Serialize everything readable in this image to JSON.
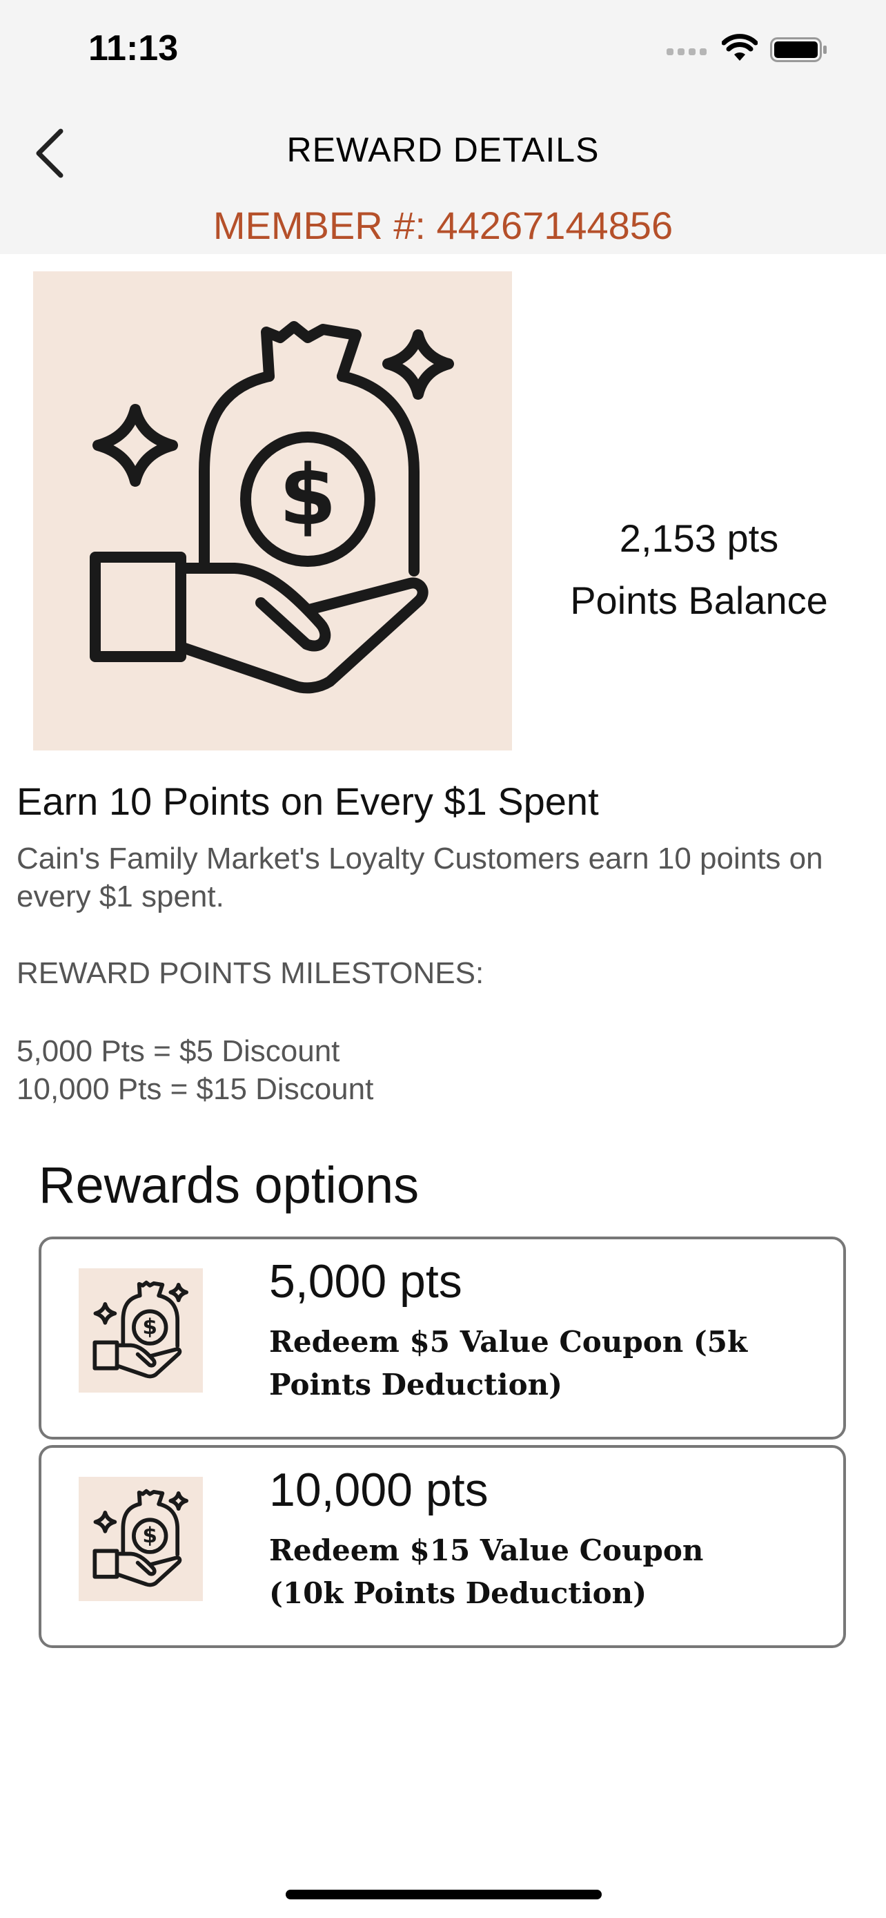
{
  "status_bar": {
    "time": "11:13"
  },
  "nav": {
    "title": "REWARD DETAILS",
    "back_icon": "chevron-left-icon"
  },
  "member": {
    "text": "MEMBER #: 44267144856"
  },
  "balance": {
    "points": "2,153 pts",
    "label": "Points Balance"
  },
  "reward": {
    "title": "Earn 10 Points on Every $1 Spent",
    "description": "Cain's Family Market's Loyalty Customers earn 10 points on every $1 spent.",
    "milestones_title": "REWARD POINTS MILESTONES:",
    "milestones": [
      "5,000 Pts = $5 Discount",
      "10,000 Pts = $15 Discount"
    ]
  },
  "options": {
    "title": "Rewards options",
    "items": [
      {
        "points": "5,000 pts",
        "description": "Redeem $5 Value Coupon (5k Points Deduction)",
        "icon": "money-bag-hand-icon"
      },
      {
        "points": "10,000 pts",
        "description": "Redeem $15 Value Coupon (10k Points Deduction)",
        "icon": "money-bag-hand-icon"
      }
    ]
  },
  "colors": {
    "accent": "#b5502a",
    "image_bg": "#f4e6dc",
    "header_bg": "#f4f4f4"
  }
}
